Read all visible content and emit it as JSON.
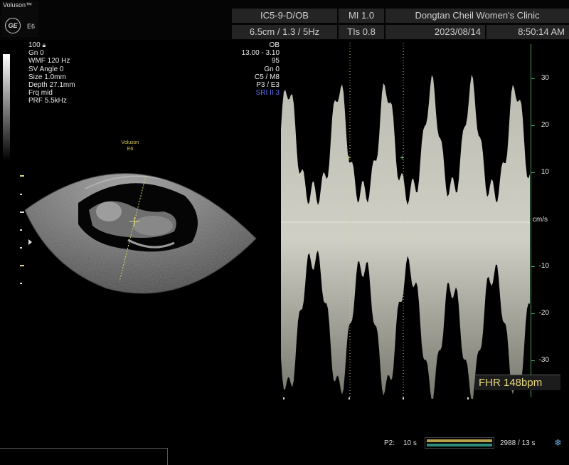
{
  "brand": {
    "name": "Voluson™",
    "model": "E6",
    "logo": "GE"
  },
  "header": {
    "probe": "IC5-9-D/OB",
    "mi": "MI  1.0",
    "clinic": "Dongtan Cheil Women's Clinic",
    "depth_info": "6.5cm / 1.3 /  5Hz",
    "tis": "TIs  0.8",
    "date": "2023/08/14",
    "time": "8:50:14 AM"
  },
  "left_params": [
    "100",
    "Gn  0",
    "WMF 120 Hz",
    "SV Angle  0",
    "Size  1.0mm",
    "Depth 27.1mm",
    "Frq mid",
    "PRF  5.5kHz"
  ],
  "right_params": [
    "OB",
    "13.00 - 3.10",
    "95",
    "Gn  0",
    "C5 / M8",
    "P3 / E3",
    "SRI II 3"
  ],
  "image_watermark": {
    "brand": "Voluson",
    "model": "E6"
  },
  "velocity_axis": {
    "unit": "cm/s",
    "ticks": [
      "30",
      "20",
      "10",
      "-10",
      "-20",
      "-30"
    ]
  },
  "fhr": "FHR 148bpm",
  "footer": {
    "p2_label": "P2:",
    "p2_value": "10 s",
    "frames": "2988 / 13 s"
  },
  "icons": {
    "lock": "lock-icon",
    "freeze": "snowflake-icon",
    "brand": "ge-logo-icon"
  }
}
